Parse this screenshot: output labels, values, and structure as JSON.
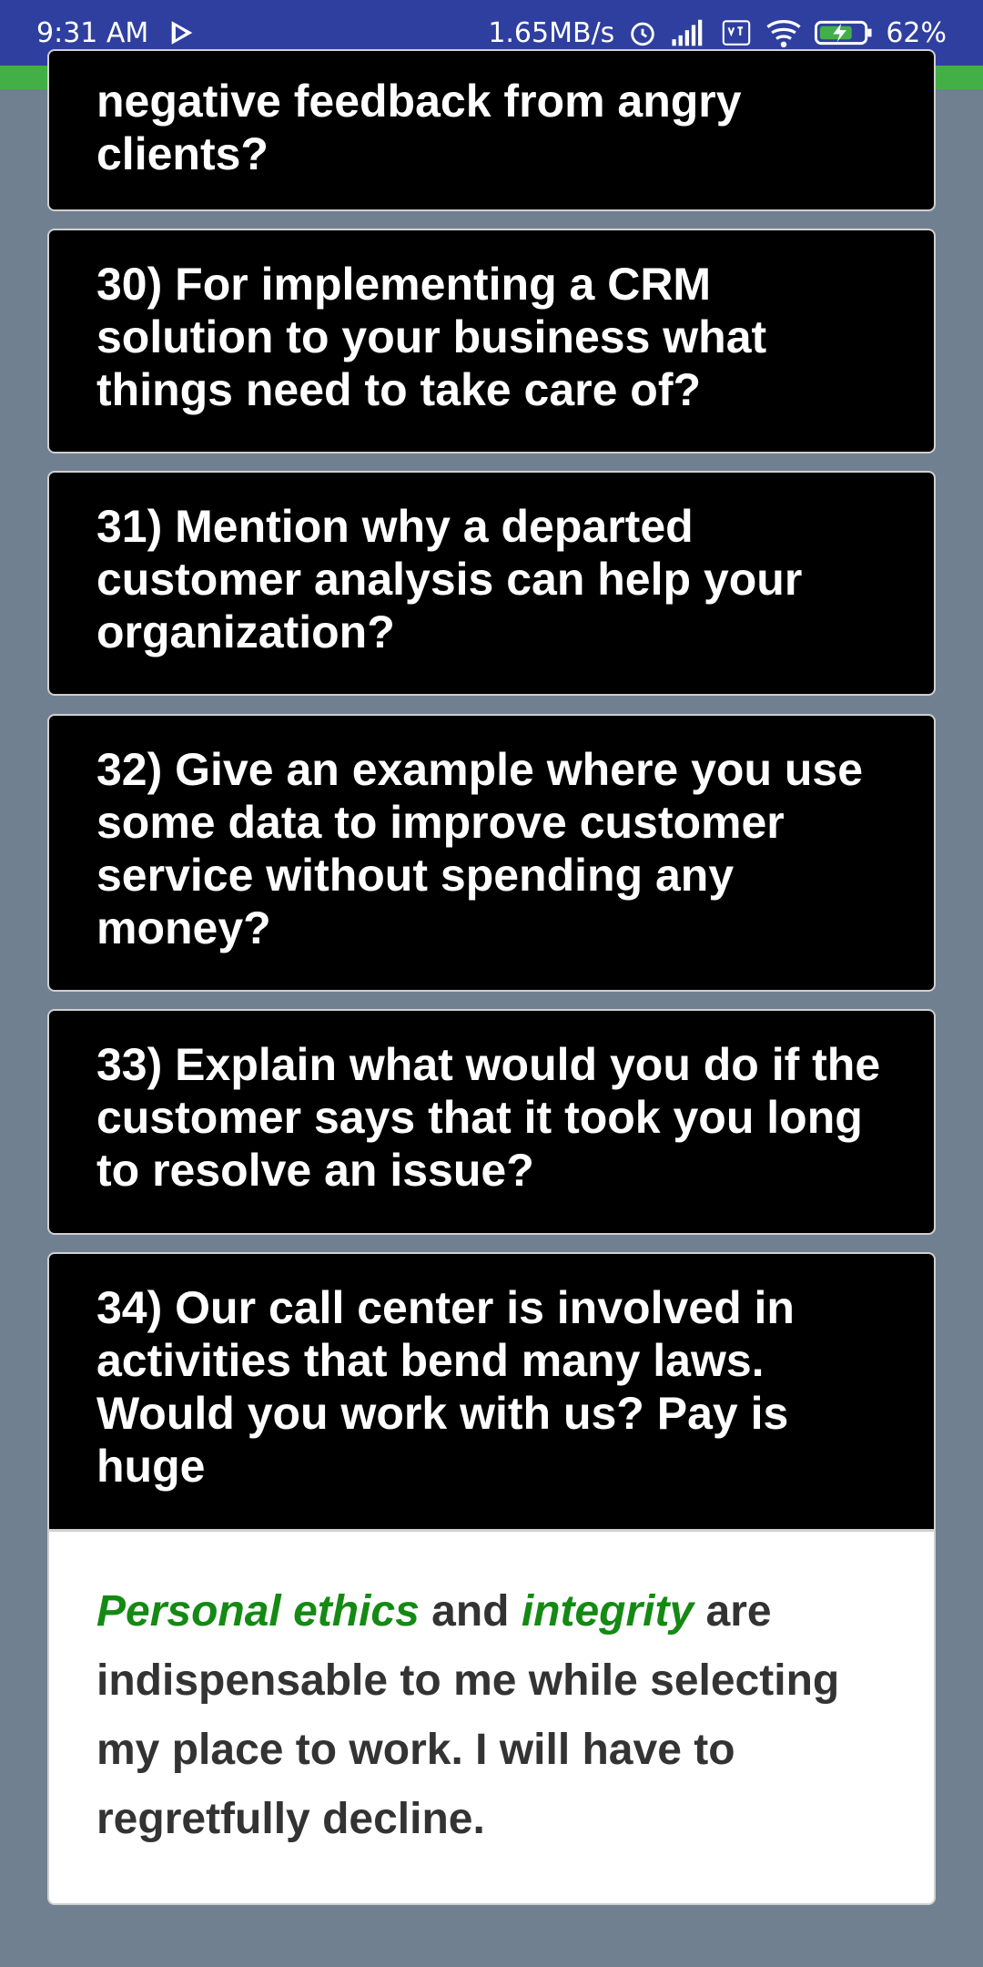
{
  "status_bar": {
    "time": "9:31 AM",
    "speed": "1.65MB/s",
    "battery": "62%"
  },
  "questions": [
    {
      "text": "negative feedback from angry clients?"
    },
    {
      "text": "30) For implementing a CRM solution to your business what things need to take care of?"
    },
    {
      "text": "31) Mention why a departed customer analysis can help your organization?"
    },
    {
      "text": "32) Give an example where you use some data to improve customer service without spending any money?"
    },
    {
      "text": "33) Explain what would you do if the customer says that it took you long to resolve an issue?"
    },
    {
      "text": "34) Our call center is involved in activities that bend many laws. Would you work with us? Pay is huge"
    }
  ],
  "answer": {
    "keyword1": "Personal ethics",
    "text1": " and ",
    "keyword2": "integrity",
    "text2": " are indispensable to me while selecting my place to work. I will have to regretfully decline."
  },
  "colors": {
    "status_bar": "#2f3fa0",
    "accent_green": "#43b047",
    "keyword_green": "#148a14",
    "background": "#708090"
  }
}
